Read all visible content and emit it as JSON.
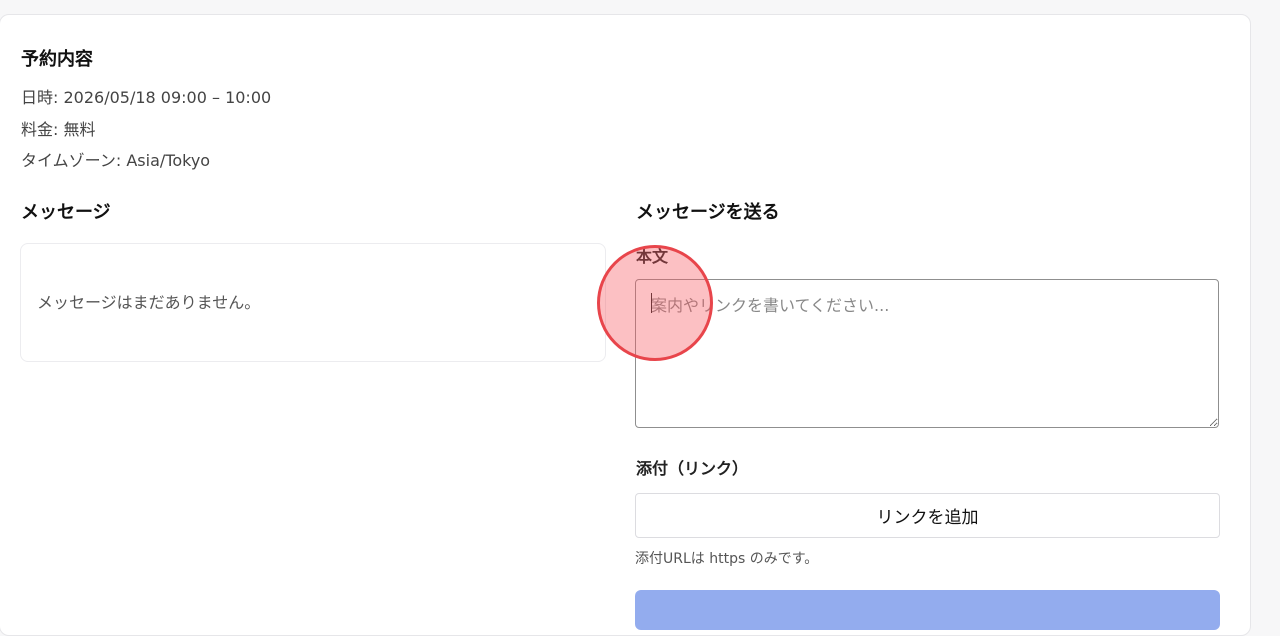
{
  "booking": {
    "title": "予約内容",
    "datetime": "日時: 2026/05/18 09:00 – 10:00",
    "fee": "料金: 無料",
    "timezone": "タイムゾーン: Asia/Tokyo"
  },
  "messages": {
    "title": "メッセージ",
    "empty_text": "メッセージはまだありません。"
  },
  "send": {
    "title": "メッセージを送る",
    "body_label": "本文",
    "body_placeholder": "案内やリンクを書いてください...",
    "body_value": "",
    "attachment_label": "添付（リンク）",
    "add_link_label": "リンクを追加",
    "hint": "添付URLは https のみです。",
    "send_button_color": "#93acee"
  },
  "colors": {
    "click_indicator": "#e8454b"
  }
}
